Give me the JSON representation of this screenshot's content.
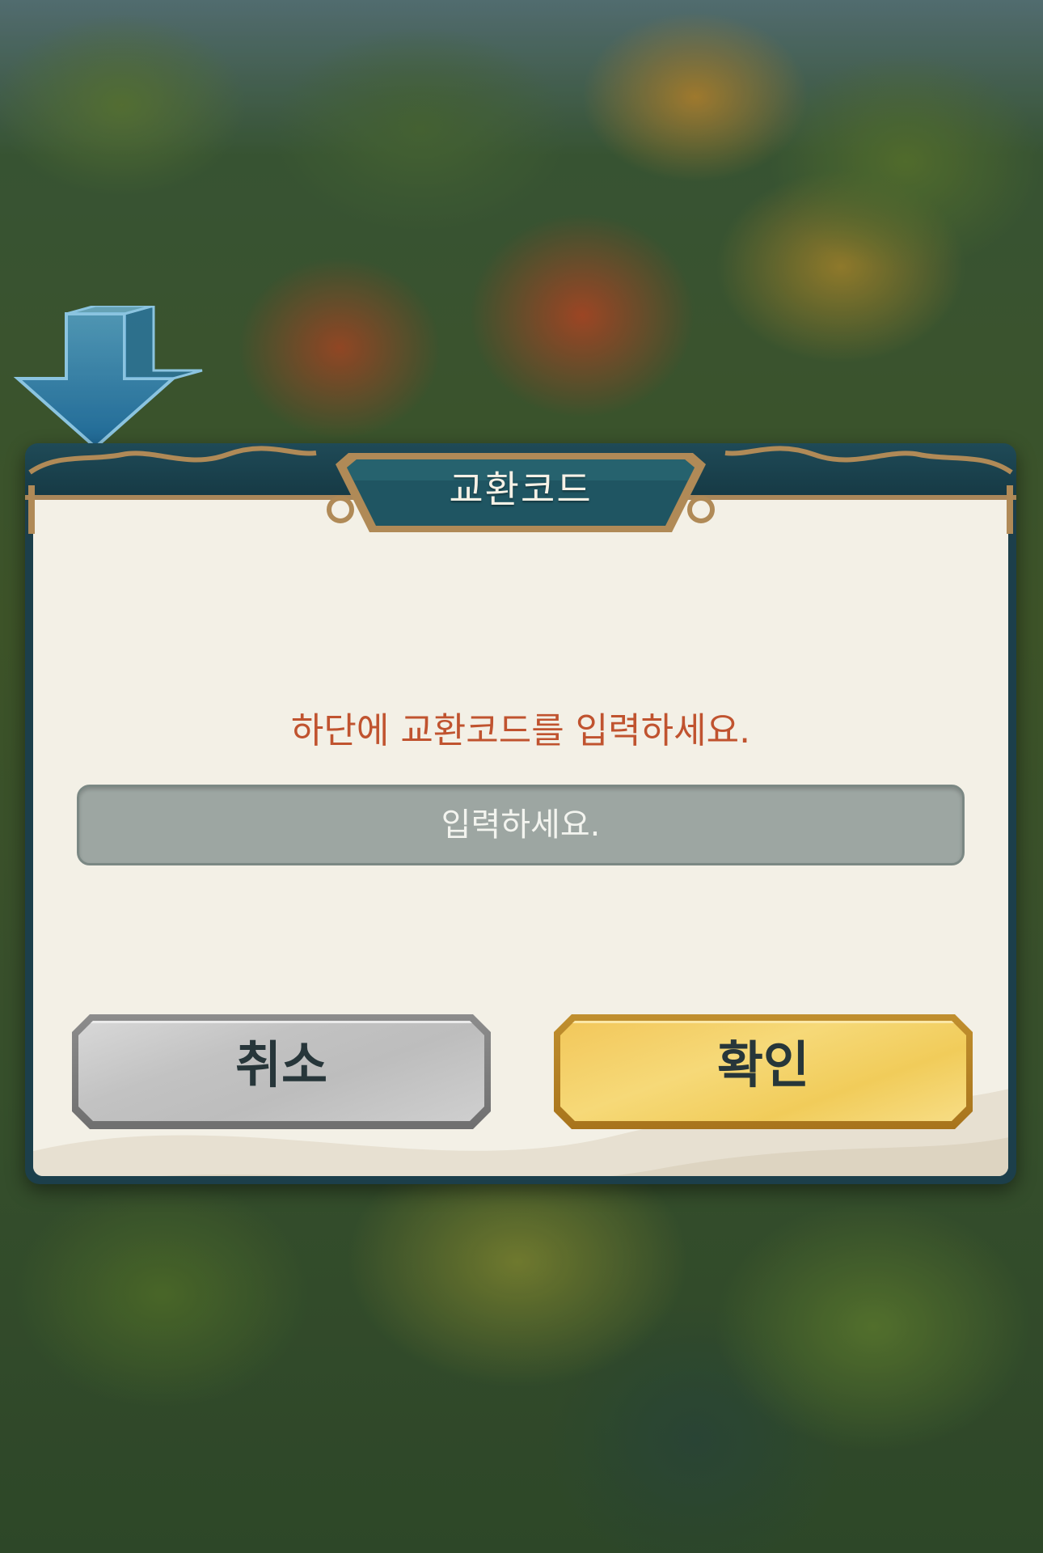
{
  "dialog": {
    "title": "교환코드",
    "prompt": "하단에 교환코드를 입력하세요.",
    "input": {
      "placeholder": "입력하세요.",
      "value": ""
    },
    "cancel_label": "취소",
    "confirm_label": "확인"
  },
  "colors": {
    "prompt_text": "#c0532f",
    "header": "#1f4a57",
    "frame_trim": "#a9875a",
    "panel": "#f3f0e6",
    "input_bg": "#9da6a2",
    "cancel_button": "#c2c2c2",
    "confirm_button": "#f2c75a"
  },
  "icons": {
    "background_arrow": "down-arrow-icon"
  }
}
